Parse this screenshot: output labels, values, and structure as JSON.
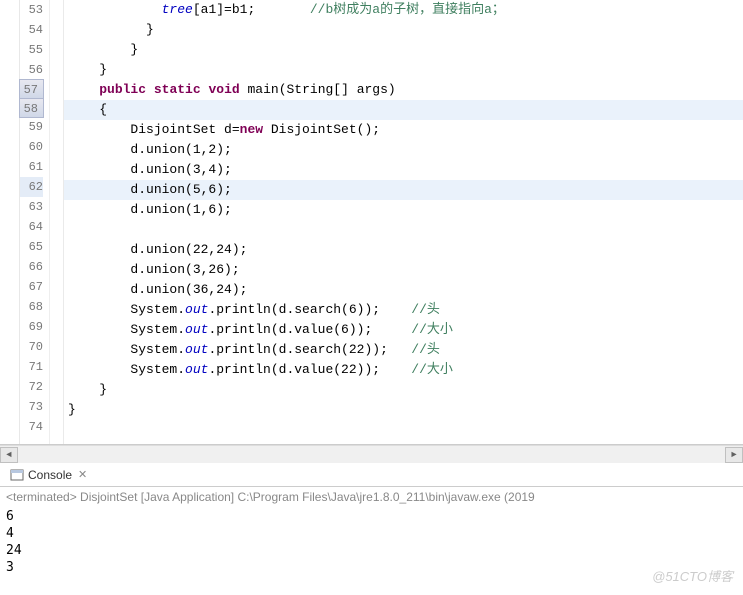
{
  "editor": {
    "lines": [
      {
        "num": 53,
        "indent": "            ",
        "tokens": [
          {
            "t": "field",
            "v": "tree"
          },
          {
            "t": "",
            "v": "[a1]=b1;       "
          },
          {
            "t": "comment",
            "v": "//b树成为a的子树，直接指向a；"
          }
        ]
      },
      {
        "num": 54,
        "indent": "          ",
        "tokens": [
          {
            "t": "",
            "v": "}"
          }
        ]
      },
      {
        "num": 55,
        "indent": "        ",
        "tokens": [
          {
            "t": "",
            "v": "}"
          }
        ]
      },
      {
        "num": 56,
        "indent": "    ",
        "tokens": [
          {
            "t": "",
            "v": "}"
          }
        ]
      },
      {
        "num": 57,
        "hl": true,
        "fold": true,
        "indent": "    ",
        "tokens": [
          {
            "t": "kw",
            "v": "public"
          },
          {
            "t": "",
            "v": " "
          },
          {
            "t": "kw",
            "v": "static"
          },
          {
            "t": "",
            "v": " "
          },
          {
            "t": "kw",
            "v": "void"
          },
          {
            "t": "",
            "v": " main(String[] args)"
          }
        ]
      },
      {
        "num": 58,
        "hl": true,
        "cur": true,
        "indent": "    ",
        "tokens": [
          {
            "t": "",
            "v": "{"
          }
        ]
      },
      {
        "num": 59,
        "indent": "        ",
        "tokens": [
          {
            "t": "",
            "v": "DisjointSet d="
          },
          {
            "t": "kw",
            "v": "new"
          },
          {
            "t": "",
            "v": " DisjointSet();"
          }
        ]
      },
      {
        "num": 60,
        "indent": "        ",
        "tokens": [
          {
            "t": "",
            "v": "d.union(1,2);"
          }
        ]
      },
      {
        "num": 61,
        "indent": "        ",
        "tokens": [
          {
            "t": "",
            "v": "d.union(3,4);"
          }
        ]
      },
      {
        "num": 62,
        "cur": true,
        "indent": "        ",
        "tokens": [
          {
            "t": "",
            "v": "d.union(5,6);"
          }
        ]
      },
      {
        "num": 63,
        "indent": "        ",
        "tokens": [
          {
            "t": "",
            "v": "d.union(1,6);"
          }
        ]
      },
      {
        "num": 64,
        "indent": "",
        "tokens": []
      },
      {
        "num": 65,
        "indent": "        ",
        "tokens": [
          {
            "t": "",
            "v": "d.union(22,24);"
          }
        ]
      },
      {
        "num": 66,
        "indent": "        ",
        "tokens": [
          {
            "t": "",
            "v": "d.union(3,26);"
          }
        ]
      },
      {
        "num": 67,
        "indent": "        ",
        "tokens": [
          {
            "t": "",
            "v": "d.union(36,24);"
          }
        ]
      },
      {
        "num": 68,
        "indent": "        ",
        "tokens": [
          {
            "t": "",
            "v": "System."
          },
          {
            "t": "static",
            "v": "out"
          },
          {
            "t": "",
            "v": ".println(d.search(6));    "
          },
          {
            "t": "comment",
            "v": "//头"
          }
        ]
      },
      {
        "num": 69,
        "indent": "        ",
        "tokens": [
          {
            "t": "",
            "v": "System."
          },
          {
            "t": "static",
            "v": "out"
          },
          {
            "t": "",
            "v": ".println(d.value(6));     "
          },
          {
            "t": "comment",
            "v": "//大小"
          }
        ]
      },
      {
        "num": 70,
        "indent": "        ",
        "tokens": [
          {
            "t": "",
            "v": "System."
          },
          {
            "t": "static",
            "v": "out"
          },
          {
            "t": "",
            "v": ".println(d.search(22));   "
          },
          {
            "t": "comment",
            "v": "//头"
          }
        ]
      },
      {
        "num": 71,
        "indent": "        ",
        "tokens": [
          {
            "t": "",
            "v": "System."
          },
          {
            "t": "static",
            "v": "out"
          },
          {
            "t": "",
            "v": ".println(d.value(22));    "
          },
          {
            "t": "comment",
            "v": "//大小"
          }
        ]
      },
      {
        "num": 72,
        "indent": "    ",
        "tokens": [
          {
            "t": "",
            "v": "}"
          }
        ]
      },
      {
        "num": 73,
        "indent": "",
        "tokens": [
          {
            "t": "",
            "v": "}"
          }
        ]
      },
      {
        "num": 74,
        "indent": "",
        "tokens": []
      }
    ]
  },
  "console": {
    "tab_label": "Console",
    "status": "<terminated> DisjointSet [Java Application] C:\\Program Files\\Java\\jre1.8.0_211\\bin\\javaw.exe (2019",
    "output": [
      "6",
      "4",
      "24",
      "3"
    ]
  },
  "watermark": "@51CTO博客"
}
